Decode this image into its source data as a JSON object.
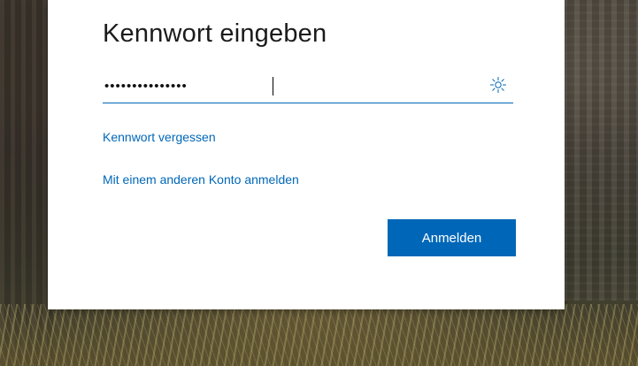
{
  "dialog": {
    "title": "Kennwort eingeben",
    "password_value": "•••••••••••••••",
    "reveal_icon": "reveal-password-icon",
    "forgot_link": "Kennwort vergessen",
    "other_account_link": "Mit einem anderen Konto anmelden",
    "signin_button": "Anmelden"
  },
  "colors": {
    "accent": "#0067b8",
    "dialog_bg": "#ffffff",
    "title_text": "#1b1b1b"
  }
}
